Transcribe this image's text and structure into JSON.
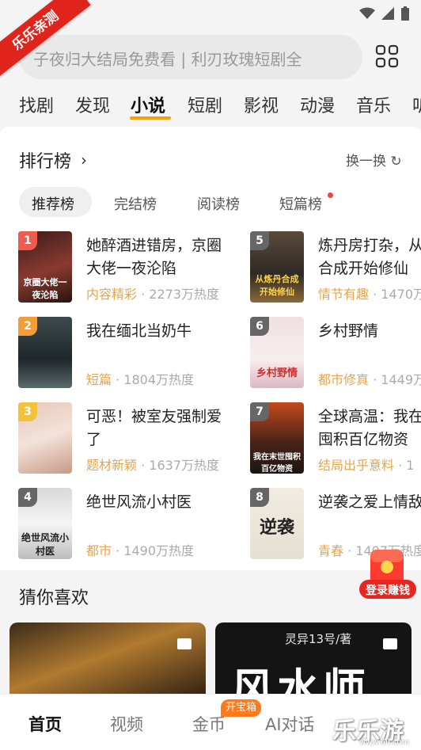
{
  "ribbon": "乐乐亲测",
  "search": {
    "placeholder": "子夜归大结局免费看 | 利刃玫瑰短剧全"
  },
  "tabs": [
    "找剧",
    "发现",
    "小说",
    "短剧",
    "影视",
    "动漫",
    "音乐",
    "听"
  ],
  "ranking": {
    "title": "排行榜",
    "refresh": "换一换",
    "subtabs": [
      "推荐榜",
      "完结榜",
      "阅读榜",
      "短篇榜"
    ]
  },
  "books": [
    {
      "rank": "1",
      "title1": "她醉酒进错房，京圈",
      "title2": "大佬一夜沦陷",
      "tag": "内容精彩",
      "heat": "2273万热度",
      "cover_title": "京圈大佬一夜沦陷"
    },
    {
      "rank": "2",
      "title1": "我在缅北当奶牛",
      "title2": "",
      "tag": "短篇",
      "heat": "1804万热度",
      "cover_title": ""
    },
    {
      "rank": "3",
      "title1": "可恶！被室友强制爱",
      "title2": "了",
      "tag": "题材新颖",
      "heat": "1637万热度",
      "cover_title": ""
    },
    {
      "rank": "4",
      "title1": "绝世风流小村医",
      "title2": "",
      "tag": "都市",
      "heat": "1490万热度",
      "cover_title": "绝世风流小村医"
    },
    {
      "rank": "5",
      "title1": "炼丹房打杂，从",
      "title2": "合成开始修仙",
      "tag": "情节有趣",
      "heat": "1470万",
      "cover_title": "从炼丹合成开始修仙"
    },
    {
      "rank": "6",
      "title1": "乡村野情",
      "title2": "",
      "tag": "都市修真",
      "heat": "1449万",
      "cover_title": "乡村野情"
    },
    {
      "rank": "7",
      "title1": "全球高温：我在",
      "title2": "囤积百亿物资",
      "tag": "结局出乎意料",
      "heat": "1",
      "cover_title": "我在末世囤积百亿物资"
    },
    {
      "rank": "8",
      "title1": "逆袭之爱上情敌",
      "title2": "",
      "tag": "青春",
      "heat": "1407万热度",
      "cover_title": "逆袭"
    }
  ],
  "guess": {
    "title": "猜你喜欢",
    "card2_author": "灵异13号/著",
    "card2_title": "风水师"
  },
  "float_button": "登录赚钱",
  "bottom_nav": [
    "首页",
    "视频",
    "金币",
    "AI对话"
  ],
  "badge": "开宝箱",
  "watermark": "乐乐游戏",
  "watermark_sub": "www.6ll.com",
  "colors": {
    "accent": "#f5a300",
    "tag": "#e8a447",
    "red": "#e0231b"
  }
}
